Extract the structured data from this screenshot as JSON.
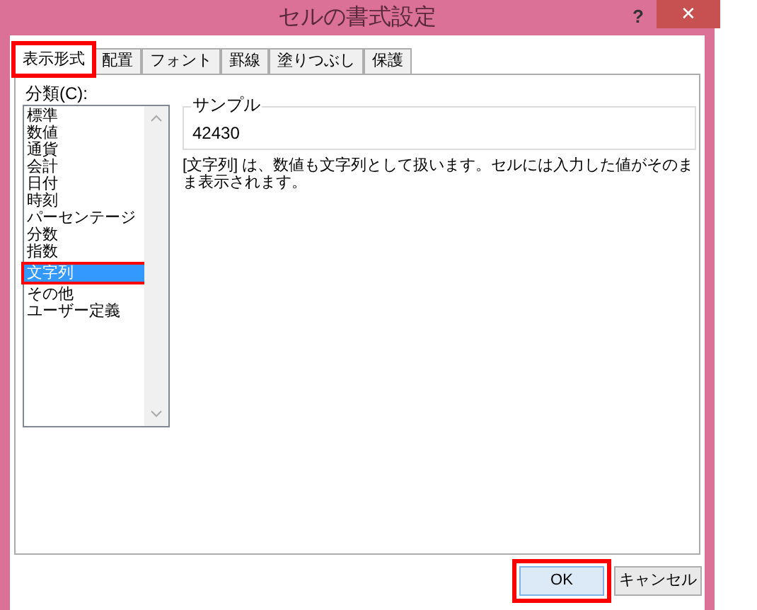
{
  "window": {
    "title": "セルの書式設定",
    "help": "?",
    "close": "✕"
  },
  "tabs": [
    {
      "label": "表示形式",
      "selected": true,
      "highlighted": true
    },
    {
      "label": "配置",
      "selected": false,
      "highlighted": false
    },
    {
      "label": "フォント",
      "selected": false,
      "highlighted": false
    },
    {
      "label": "罫線",
      "selected": false,
      "highlighted": false
    },
    {
      "label": "塗りつぶし",
      "selected": false,
      "highlighted": false
    },
    {
      "label": "保護",
      "selected": false,
      "highlighted": false
    }
  ],
  "category": {
    "label": "分類(C):",
    "items": [
      {
        "label": "標準",
        "selected": false,
        "highlighted": false
      },
      {
        "label": "数値",
        "selected": false,
        "highlighted": false
      },
      {
        "label": "通貨",
        "selected": false,
        "highlighted": false
      },
      {
        "label": "会計",
        "selected": false,
        "highlighted": false
      },
      {
        "label": "日付",
        "selected": false,
        "highlighted": false
      },
      {
        "label": "時刻",
        "selected": false,
        "highlighted": false
      },
      {
        "label": "パーセンテージ",
        "selected": false,
        "highlighted": false
      },
      {
        "label": "分数",
        "selected": false,
        "highlighted": false
      },
      {
        "label": "指数",
        "selected": false,
        "highlighted": false
      },
      {
        "label": "文字列",
        "selected": true,
        "highlighted": true
      },
      {
        "label": "その他",
        "selected": false,
        "highlighted": false
      },
      {
        "label": "ユーザー定義",
        "selected": false,
        "highlighted": false
      }
    ]
  },
  "sample": {
    "label": "サンプル",
    "value": "42430"
  },
  "description": "[文字列] は、数値も文字列として扱います。セルには入力した値がそのまま表示されます。",
  "buttons": [
    {
      "label": "OK",
      "highlighted": true
    },
    {
      "label": "キャンセル",
      "highlighted": false
    }
  ]
}
